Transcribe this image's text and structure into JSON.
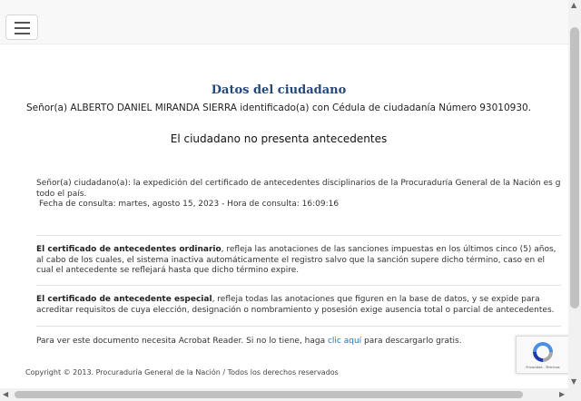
{
  "header": {
    "menu_icon": "hamburger-icon"
  },
  "main": {
    "title": "Datos del ciudadano",
    "citizen_line": "Señor(a)  ALBERTO DANIEL MIRANDA SIERRA identificado(a) con Cédula de ciudadanía Número 93010930.",
    "status": "El ciudadano no presenta antecedentes",
    "info_line1": "Señor(a) ciudadano(a): la expedición del certificado de antecedentes disciplinarios de la Procuraduría General de la Nación es gratuita en",
    "info_line2": "todo el país.",
    "consult_date": "Fecha de consulta: martes, agosto 15, 2023 - Hora de consulta: 16:09:16",
    "ordinary_bold": "El certificado de antecedentes ordinario",
    "ordinary_text": ", refleja las anotaciones de las sanciones impuestas en los últimos cinco (5) años, al cabo de los cuales, el sistema inactiva automáticamente el registro salvo que la sanción supere dicho término, caso en el cual el antecedente se reflejará hasta que dicho término expire.",
    "special_bold": "El certificado de antecedente especial",
    "special_text": ", refleja todas las anotaciones que figuren en la base de datos, y se expide para acreditar requisitos de cuya elección, designación o nombramiento y posesión exige ausencia total o parcial de antecedentes.",
    "acrobat_text": "Para ver este documento necesita Acrobat Reader. Si no lo tiene, haga ",
    "acrobat_link": "clic aquí",
    "acrobat_tail": " para descargarlo gratis."
  },
  "footer": {
    "copyright": "Copyright © 2013. Procuraduría General de la Nación / Todos los derechos reservados"
  },
  "recaptcha": {
    "icon": "recaptcha-icon",
    "text": "Privacidad - Términos"
  }
}
